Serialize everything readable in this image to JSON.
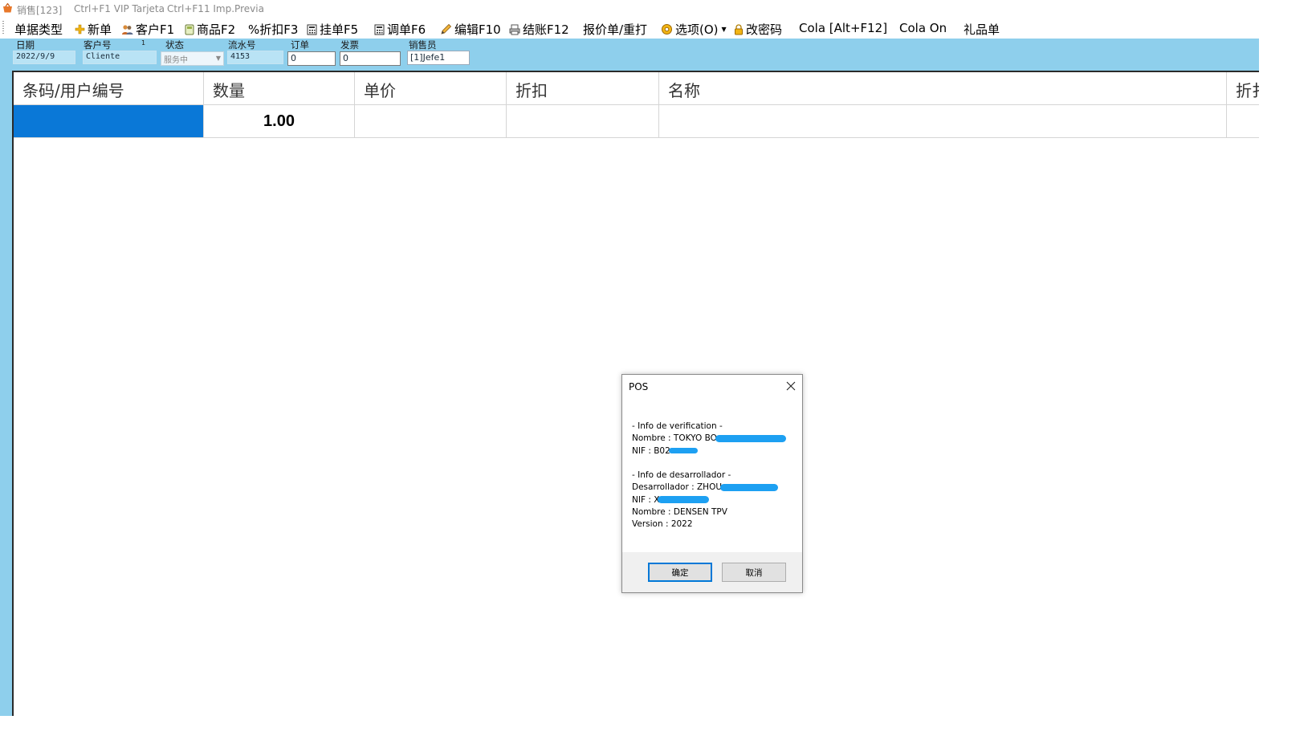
{
  "window": {
    "title": "销售[123]",
    "hint1": "Ctrl+F1 VIP Tarjeta",
    "hint2": "Ctrl+F11 Imp.Previa"
  },
  "menu": {
    "items": [
      {
        "label": "单据类型",
        "icon": ""
      },
      {
        "label": "新单",
        "icon": "plus-icon"
      },
      {
        "label": "客户F1",
        "icon": "users-icon"
      },
      {
        "label": "商品F2",
        "icon": "product-icon"
      },
      {
        "label": "%折扣F3",
        "icon": ""
      },
      {
        "label": "挂单F5",
        "icon": "calculator-icon"
      },
      {
        "label": "调单F6",
        "icon": "calculator-icon"
      },
      {
        "label": "编辑F10",
        "icon": "pencil-icon"
      },
      {
        "label": "结账F12",
        "icon": "printer-icon"
      },
      {
        "label": "报价单/重打",
        "icon": ""
      },
      {
        "label": "选项(O)",
        "icon": "options-icon"
      },
      {
        "label": "改密码",
        "icon": "lock-icon"
      },
      {
        "label": "Cola [Alt+F12]",
        "icon": ""
      },
      {
        "label": "Cola On",
        "icon": ""
      },
      {
        "label": "礼品单",
        "icon": ""
      }
    ]
  },
  "fields": {
    "date": {
      "label": "日期",
      "value": "2022/9/9"
    },
    "customer": {
      "label": "客户号",
      "value": "Cliente",
      "count": "1"
    },
    "status": {
      "label": "状态",
      "value": "服务中"
    },
    "serial": {
      "label": "流水号",
      "value": "4153"
    },
    "order": {
      "label": "订单",
      "value": "0"
    },
    "invoice": {
      "label": "发票",
      "value": "0"
    },
    "seller": {
      "label": "销售员",
      "value": "[1]Jefe1"
    }
  },
  "grid": {
    "columns": [
      "条码/用户编号",
      "数量",
      "单价",
      "折扣",
      "名称",
      "折扌"
    ],
    "rows": [
      {
        "barcode": "",
        "qty": "1.00",
        "price": "",
        "discount": "",
        "name": "",
        "extra": ""
      }
    ]
  },
  "dialog": {
    "title": "POS",
    "line1": " - Info de verification -",
    "line2": "Nombre : TOKYO BO",
    "line3": "NIF : B02",
    "line4": " - Info de desarrollador -",
    "line5": "Desarrollador : ZHOU",
    "line6": "NIF : X",
    "line7": "Nombre : DENSEN TPV",
    "line8": "Version : 2022",
    "ok": "确定",
    "cancel": "取消"
  },
  "colors": {
    "accent": "#8ecfec",
    "selection": "#0a78d7",
    "redaction": "#1da0f2",
    "dialog_default_border": "#0078d7"
  }
}
